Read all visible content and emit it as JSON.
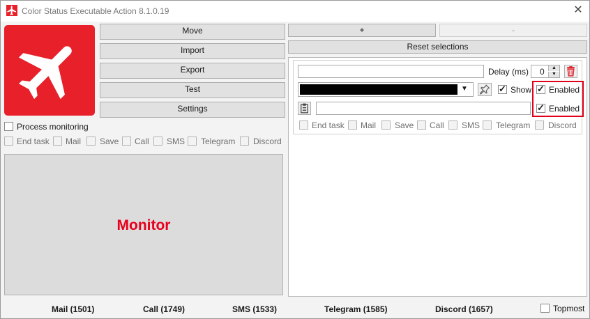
{
  "window": {
    "title": "Color Status Executable Action 8.1.0.19"
  },
  "left_buttons": {
    "move": "Move",
    "import": "Import",
    "export": "Export",
    "test": "Test",
    "settings": "Settings"
  },
  "process_monitoring": {
    "label": "Process monitoring",
    "checked": false
  },
  "left_options": [
    "End task",
    "Mail",
    "Save",
    "Call",
    "SMS",
    "Telegram",
    "Discord"
  ],
  "monitor": {
    "label": "Monitor"
  },
  "top_right": {
    "add": "+",
    "remove": "-",
    "reset": "Reset selections"
  },
  "action": {
    "name_value": "",
    "delay_label": "Delay (ms)",
    "delay_value": "0",
    "color_value": "#000000",
    "show_label": "Show",
    "enabled_label_1": "Enabled",
    "enabled_label_2": "Enabled",
    "path_value": "",
    "options": [
      "End task",
      "Mail",
      "Save",
      "Call",
      "SMS",
      "Telegram",
      "Discord"
    ]
  },
  "status_bar": {
    "mail": "Mail (1501)",
    "call": "Call (1749)",
    "sms": "SMS (1533)",
    "telegram": "Telegram (1585)",
    "discord": "Discord (1657)",
    "topmost": "Topmost"
  },
  "colors": {
    "accent_red": "#e8001c",
    "logo_red": "#e8202a"
  },
  "icons": {
    "app": "airplane-icon",
    "logo": "airplane-icon",
    "delete": "trash-icon",
    "pick": "pin-icon",
    "file": "clipboard-icon"
  }
}
